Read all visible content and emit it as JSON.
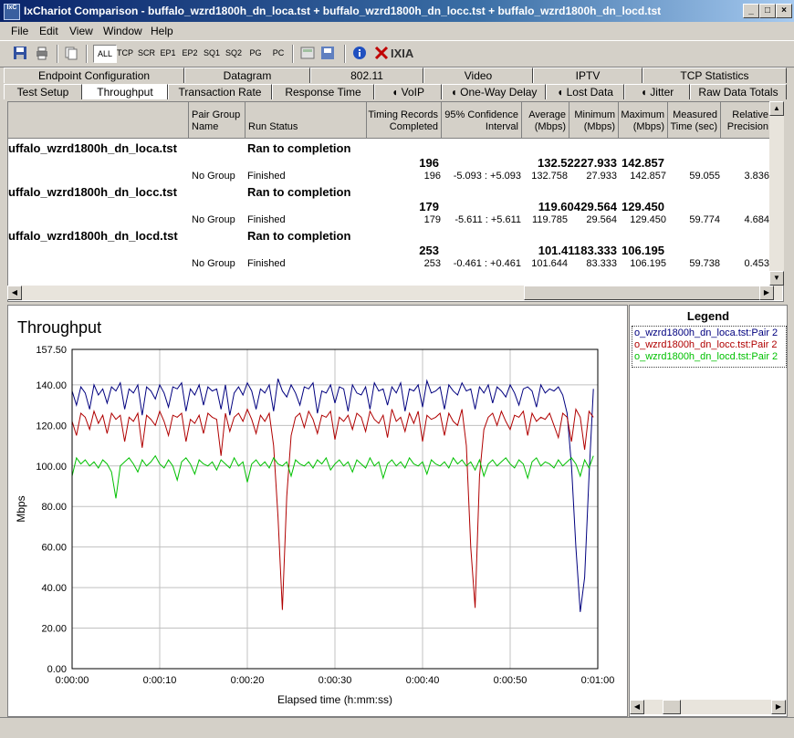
{
  "window": {
    "title": "IxChariot Comparison - buffalo_wzrd1800h_dn_loca.tst + buffalo_wzrd1800h_dn_locc.tst + buffalo_wzrd1800h_dn_locd.tst",
    "icon_text": "IxC"
  },
  "menu": [
    "File",
    "Edit",
    "View",
    "Window",
    "Help"
  ],
  "toolbar": {
    "filters": [
      "ALL",
      "TCP",
      "SCR",
      "EP1",
      "EP2",
      "SQ1",
      "SQ2",
      "PG",
      "PC"
    ],
    "brand": "IXIA"
  },
  "tabs_back": [
    "Endpoint Configuration",
    "Datagram",
    "802.11",
    "Video",
    "IPTV",
    "TCP Statistics"
  ],
  "tabs_front": [
    "Test Setup",
    "Throughput",
    "Transaction Rate",
    "Response Time",
    "VoIP",
    "One-Way Delay",
    "Lost Data",
    "Jitter",
    "Raw Data Totals"
  ],
  "grid": {
    "headers": {
      "pair_group": "Pair Group Name",
      "run_status": "Run Status",
      "timing": "Timing Records Completed",
      "confidence": "95% Confidence Interval",
      "average": "Average (Mbps)",
      "minimum": "Minimum (Mbps)",
      "maximum": "Maximum (Mbps)",
      "measured": "Measured Time (sec)",
      "relative": "Relative Precision"
    },
    "tests": [
      {
        "name": "uffalo_wzrd1800h_dn_loca.tst",
        "status": "Ran to completion",
        "summary": {
          "records": "196",
          "avg": "132.522",
          "min": "27.933",
          "max": "142.857"
        },
        "pair": {
          "group": "No Group",
          "status": "Finished",
          "records": "196",
          "ci": "-5.093 : +5.093",
          "avg": "132.758",
          "min": "27.933",
          "max": "142.857",
          "time": "59.055",
          "rp": "3.836"
        }
      },
      {
        "name": "uffalo_wzrd1800h_dn_locc.tst",
        "status": "Ran to completion",
        "summary": {
          "records": "179",
          "avg": "119.604",
          "min": "29.564",
          "max": "129.450"
        },
        "pair": {
          "group": "No Group",
          "status": "Finished",
          "records": "179",
          "ci": "-5.611 : +5.611",
          "avg": "119.785",
          "min": "29.564",
          "max": "129.450",
          "time": "59.774",
          "rp": "4.684"
        }
      },
      {
        "name": "uffalo_wzrd1800h_dn_locd.tst",
        "status": "Ran to completion",
        "summary": {
          "records": "253",
          "avg": "101.411",
          "min": "83.333",
          "max": "106.195"
        },
        "pair": {
          "group": "No Group",
          "status": "Finished",
          "records": "253",
          "ci": "-0.461 : +0.461",
          "avg": "101.644",
          "min": "83.333",
          "max": "106.195",
          "time": "59.738",
          "rp": "0.453"
        }
      }
    ]
  },
  "legend": {
    "title": "Legend",
    "items": [
      {
        "label": "o_wzrd1800h_dn_loca.tst:Pair 2",
        "color": "#00007f"
      },
      {
        "label": "o_wzrd1800h_dn_locc.tst:Pair 2",
        "color": "#b00000"
      },
      {
        "label": "o_wzrd1800h_dn_locd.tst:Pair 2",
        "color": "#00c000"
      }
    ]
  },
  "chart_data": {
    "type": "line",
    "title": "Throughput",
    "xlabel": "Elapsed time (h:mm:ss)",
    "ylabel": "Mbps",
    "xlim": [
      0,
      60
    ],
    "ylim": [
      0,
      157.5
    ],
    "yticks": [
      "0.00",
      "20.00",
      "40.00",
      "60.00",
      "80.00",
      "100.00",
      "120.00",
      "140.00",
      "157.50"
    ],
    "xticks": [
      "0:00:00",
      "0:00:10",
      "0:00:20",
      "0:00:30",
      "0:00:40",
      "0:00:50",
      "0:01:00"
    ],
    "grid": true,
    "series": [
      {
        "name": "o_wzrd1800h_dn_loca.tst:Pair 2",
        "color": "#00007f",
        "x": [
          0,
          0.5,
          1,
          1.5,
          2,
          2.5,
          3,
          3.5,
          4,
          4.5,
          5,
          5.5,
          6,
          6.5,
          7,
          7.5,
          8,
          8.5,
          9,
          9.5,
          10,
          10.5,
          11,
          11.5,
          12,
          12.5,
          13,
          13.5,
          14,
          14.5,
          15,
          15.5,
          16,
          16.5,
          17,
          17.5,
          18,
          18.5,
          19,
          19.5,
          20,
          20.5,
          21,
          21.5,
          22,
          22.5,
          23,
          23.5,
          24,
          24.5,
          25,
          25.5,
          26,
          26.5,
          27,
          27.5,
          28,
          28.5,
          29,
          29.5,
          30,
          30.5,
          31,
          31.5,
          32,
          32.5,
          33,
          33.5,
          34,
          34.5,
          35,
          35.5,
          36,
          36.5,
          37,
          37.5,
          38,
          38.5,
          39,
          39.5,
          40,
          40.5,
          41,
          41.5,
          42,
          42.5,
          43,
          43.5,
          44,
          44.5,
          45,
          45.5,
          46,
          46.5,
          47,
          47.5,
          48,
          48.5,
          49,
          49.5,
          50,
          50.5,
          51,
          51.5,
          52,
          52.5,
          53,
          53.5,
          54,
          54.5,
          55,
          55.5,
          56,
          56.5,
          57,
          57.5,
          58,
          58.5,
          59,
          59.5
        ],
        "y": [
          137,
          130,
          139,
          136,
          128,
          140,
          135,
          138,
          131,
          139,
          137,
          141,
          128,
          138,
          136,
          140,
          125,
          139,
          137,
          133,
          140,
          136,
          129,
          139,
          138,
          141,
          127,
          138,
          135,
          140,
          130,
          139,
          137,
          138,
          128,
          140,
          125,
          136,
          139,
          135,
          141,
          137,
          128,
          138,
          136,
          140,
          127,
          143,
          137,
          134,
          140,
          136,
          130,
          139,
          138,
          141,
          126,
          137,
          136,
          140,
          131,
          139,
          138,
          127,
          140,
          136,
          135,
          139,
          128,
          141,
          137,
          138,
          130,
          139,
          136,
          141,
          127,
          138,
          137,
          140,
          129,
          142,
          136,
          137,
          139,
          128,
          140,
          137,
          135,
          141,
          137,
          138,
          128,
          139,
          136,
          140,
          131,
          139,
          137,
          134,
          140,
          136,
          130,
          138,
          139,
          137,
          129,
          140,
          136,
          138,
          137,
          139,
          135,
          126,
          100,
          60,
          28,
          45,
          95,
          138
        ]
      },
      {
        "name": "o_wzrd1800h_dn_locc.tst:Pair 2",
        "color": "#b00000",
        "x": [
          0,
          0.5,
          1,
          1.5,
          2,
          2.5,
          3,
          3.5,
          4,
          4.5,
          5,
          5.5,
          6,
          6.5,
          7,
          7.5,
          8,
          8.5,
          9,
          9.5,
          10,
          10.5,
          11,
          11.5,
          12,
          12.5,
          13,
          13.5,
          14,
          14.5,
          15,
          15.5,
          16,
          16.5,
          17,
          17.5,
          18,
          18.5,
          19,
          19.5,
          20,
          20.5,
          21,
          21.5,
          22,
          22.5,
          23,
          23.5,
          24,
          24.5,
          25,
          25.5,
          26,
          26.5,
          27,
          27.5,
          28,
          28.5,
          29,
          29.5,
          30,
          30.5,
          31,
          31.5,
          32,
          32.5,
          33,
          33.5,
          34,
          34.5,
          35,
          35.5,
          36,
          36.5,
          37,
          37.5,
          38,
          38.5,
          39,
          39.5,
          40,
          40.5,
          41,
          41.5,
          42,
          42.5,
          43,
          43.5,
          44,
          44.5,
          45,
          45.5,
          46,
          46.5,
          47,
          47.5,
          48,
          48.5,
          49,
          49.5,
          50,
          50.5,
          51,
          51.5,
          52,
          52.5,
          53,
          53.5,
          54,
          54.5,
          55,
          55.5,
          56,
          56.5,
          57,
          57.5,
          58,
          58.5,
          59,
          59.5
        ],
        "y": [
          122,
          115,
          126,
          124,
          118,
          127,
          121,
          125,
          116,
          126,
          123,
          125,
          112,
          124,
          122,
          126,
          109,
          125,
          123,
          120,
          127,
          122,
          115,
          125,
          124,
          126,
          112,
          123,
          121,
          125,
          116,
          126,
          124,
          123,
          105,
          126,
          117,
          124,
          126,
          122,
          128,
          123,
          116,
          125,
          122,
          126,
          110,
          75,
          29,
          85,
          115,
          124,
          126,
          119,
          127,
          123,
          116,
          125,
          124,
          127,
          113,
          124,
          122,
          125,
          118,
          126,
          124,
          117,
          127,
          123,
          121,
          125,
          114,
          128,
          122,
          124,
          117,
          126,
          121,
          127,
          112,
          125,
          123,
          124,
          126,
          115,
          126,
          122,
          120,
          128,
          110,
          60,
          30,
          95,
          118,
          124,
          126,
          120,
          127,
          122,
          118,
          125,
          124,
          127,
          115,
          126,
          122,
          124,
          123,
          126,
          120,
          114,
          126,
          124,
          112,
          128,
          124,
          108,
          127,
          124
        ]
      },
      {
        "name": "o_wzrd1800h_dn_locd.tst:Pair 2",
        "color": "#00c000",
        "x": [
          0,
          0.5,
          1,
          1.5,
          2,
          2.5,
          3,
          3.5,
          4,
          4.5,
          5,
          5.5,
          6,
          6.5,
          7,
          7.5,
          8,
          8.5,
          9,
          9.5,
          10,
          10.5,
          11,
          11.5,
          12,
          12.5,
          13,
          13.5,
          14,
          14.5,
          15,
          15.5,
          16,
          16.5,
          17,
          17.5,
          18,
          18.5,
          19,
          19.5,
          20,
          20.5,
          21,
          21.5,
          22,
          22.5,
          23,
          23.5,
          24,
          24.5,
          25,
          25.5,
          26,
          26.5,
          27,
          27.5,
          28,
          28.5,
          29,
          29.5,
          30,
          30.5,
          31,
          31.5,
          32,
          32.5,
          33,
          33.5,
          34,
          34.5,
          35,
          35.5,
          36,
          36.5,
          37,
          37.5,
          38,
          38.5,
          39,
          39.5,
          40,
          40.5,
          41,
          41.5,
          42,
          42.5,
          43,
          43.5,
          44,
          44.5,
          45,
          45.5,
          46,
          46.5,
          47,
          47.5,
          48,
          48.5,
          49,
          49.5,
          50,
          50.5,
          51,
          51.5,
          52,
          52.5,
          53,
          53.5,
          54,
          54.5,
          55,
          55.5,
          56,
          56.5,
          57,
          57.5,
          58,
          58.5,
          59,
          59.5
        ],
        "y": [
          95,
          104,
          101,
          103,
          100,
          102,
          99,
          103,
          101,
          97,
          84,
          100,
          102,
          104,
          101,
          97,
          103,
          100,
          102,
          105,
          101,
          99,
          103,
          100,
          93,
          102,
          104,
          101,
          96,
          103,
          101,
          100,
          102,
          98,
          103,
          101,
          99,
          104,
          100,
          102,
          92,
          101,
          103,
          100,
          102,
          99,
          104,
          101,
          100,
          102,
          95,
          103,
          101,
          100,
          102,
          99,
          103,
          101,
          104,
          98,
          101,
          103,
          100,
          102,
          97,
          103,
          101,
          99,
          104,
          100,
          102,
          94,
          101,
          103,
          100,
          102,
          99,
          104,
          101,
          100,
          102,
          96,
          103,
          101,
          100,
          102,
          99,
          104,
          101,
          103,
          100,
          102,
          98,
          103,
          95,
          101,
          103,
          100,
          102,
          104,
          101,
          99,
          103,
          101,
          94,
          102,
          104,
          100,
          102,
          101,
          99,
          103,
          100,
          102,
          104,
          101,
          95,
          103,
          99,
          105
        ]
      }
    ]
  }
}
